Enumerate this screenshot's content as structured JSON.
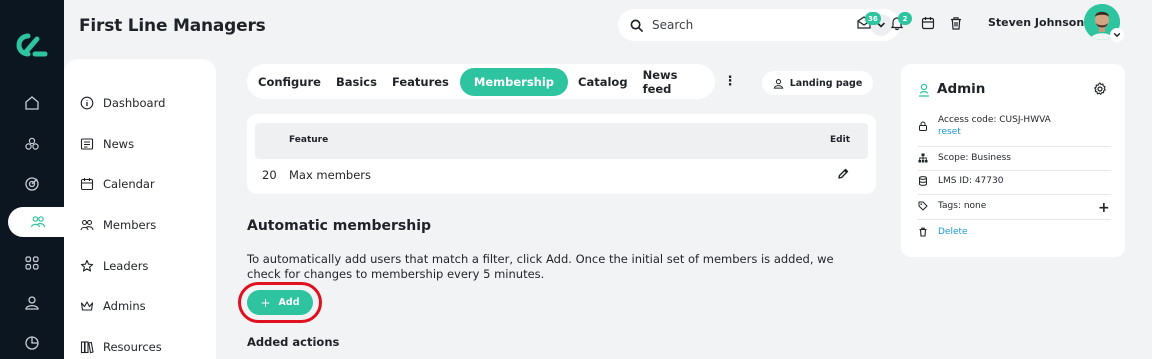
{
  "header": {
    "title": "First Line Managers",
    "search_label": "Search",
    "messages_badge": "36",
    "notifications_badge": "2",
    "user_name": "Steven Johnson"
  },
  "sidebar": {
    "items": [
      {
        "label": "Dashboard",
        "icon": "info-icon"
      },
      {
        "label": "News",
        "icon": "newspaper-icon"
      },
      {
        "label": "Calendar",
        "icon": "calendar-icon"
      },
      {
        "label": "Members",
        "icon": "people-icon"
      },
      {
        "label": "Leaders",
        "icon": "star-icon"
      },
      {
        "label": "Admins",
        "icon": "crown-icon"
      },
      {
        "label": "Resources",
        "icon": "books-icon"
      }
    ]
  },
  "tabs": {
    "items": [
      "Configure",
      "Basics",
      "Features",
      "Membership",
      "Catalog",
      "News feed"
    ],
    "active": "Membership",
    "more": "⋮",
    "landing_page": "Landing page"
  },
  "features_table": {
    "headers": {
      "feature": "Feature",
      "edit": "Edit"
    },
    "rows": [
      {
        "number": "20",
        "feature": "Max members"
      }
    ]
  },
  "automatic_membership": {
    "title": "Automatic membership",
    "description": "To automatically add users that match a filter, click Add. Once the initial set of members is added, we check for changes to membership every 5 minutes.",
    "add_button": "Add",
    "added_actions_title": "Added actions"
  },
  "admin_card": {
    "title": "Admin",
    "access_code": "Access code: CUSJ-HWVA",
    "reset": "reset",
    "scope": "Scope: Business",
    "lms_id": "LMS ID: 47730",
    "tags": "Tags: none",
    "delete": "Delete"
  },
  "colors": {
    "accent": "#2ec4a0",
    "rail_background": "#0c1620",
    "highlight_ring": "#e0101e",
    "link": "#1a9bd7"
  }
}
